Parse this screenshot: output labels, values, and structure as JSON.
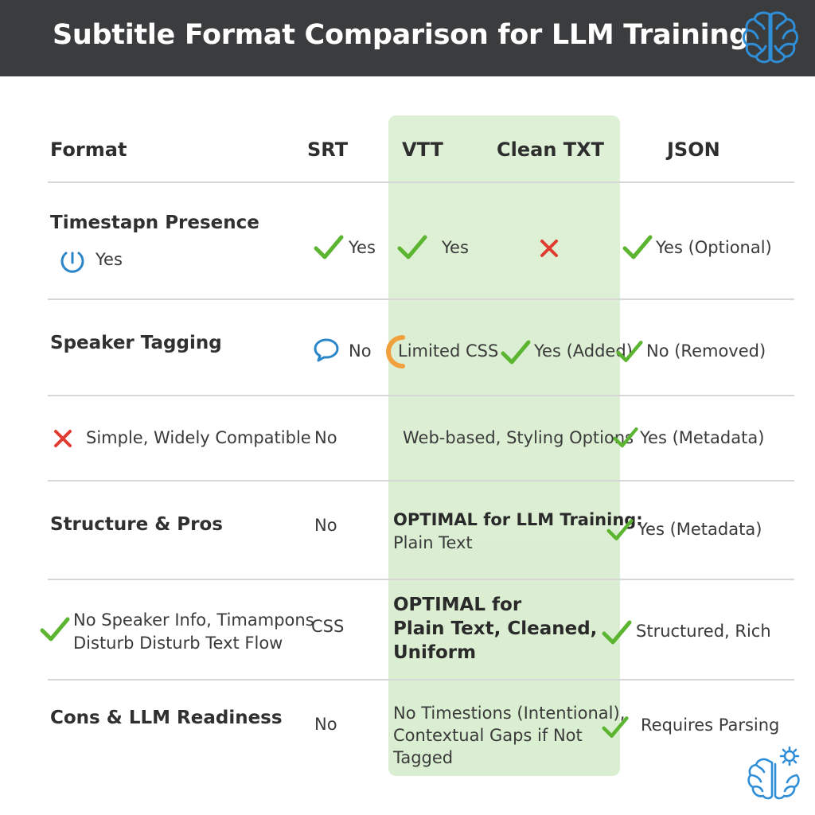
{
  "header": {
    "title": "Subtitle Format Comparison for LLM Training"
  },
  "table": {
    "columns": [
      "Format",
      "SRT",
      "VTT",
      "Clean TXT",
      "JSON"
    ],
    "rows": [
      {
        "label": "Timestapn Presence",
        "label_sub": "Yes",
        "srt": "Yes",
        "vtt": "Yes",
        "txt": "",
        "json": "Yes (Optional)"
      },
      {
        "label": "Speaker Tagging",
        "srt": "No",
        "vtt": "Limited CSS",
        "txt": "Yes (Added)",
        "json": "No (Removed)"
      },
      {
        "label": "Simple, Widely Compatible",
        "srt": "No",
        "vtt": "Web-based, Styling Options",
        "json": "Yes (Metadata)"
      },
      {
        "label": "Structure & Pros",
        "srt": "No",
        "optimal_line1": "OPTIMAL for LLM Training:",
        "optimal_line2": "Plain Text",
        "json": "Yes (Metadata)"
      },
      {
        "label_line1": "No Speaker Info, Timampons",
        "label_line2": "Disturb Disturb Text Flow",
        "srt": "CSS",
        "optimal_line1": "OPTIMAL for",
        "optimal_line2": "Plain Text, Cleaned,",
        "optimal_line3": "Uniform",
        "json": "Structured, Rich"
      },
      {
        "label": "Cons & LLM Readiness",
        "srt": "No",
        "txt_line1": "No Timestions (Intentional),",
        "txt_line2": "Contextual Gaps if Not",
        "txt_line3": "Tagged",
        "json": "Requires Parsing"
      }
    ]
  },
  "icons": {
    "check": "check-icon",
    "cross": "cross-icon",
    "clock": "clock-icon",
    "speech": "speech-bubble-icon",
    "partial": "partial-ring-icon",
    "brain": "brain-icon",
    "brain_gear": "brain-gear-icon"
  },
  "colors": {
    "header_bg": "#3b3c3e",
    "highlight": "#dcefd3",
    "check": "#5cb531",
    "cross": "#e03c31",
    "accent_blue": "#2a86c8",
    "partial": "#f0a03c"
  }
}
